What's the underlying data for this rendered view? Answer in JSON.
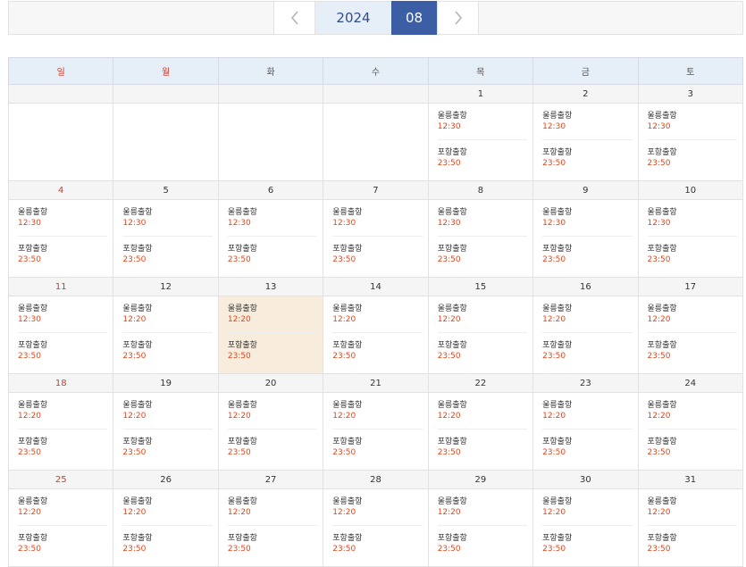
{
  "nav": {
    "year": "2024",
    "month": "08"
  },
  "weekdays": [
    "일",
    "월",
    "화",
    "수",
    "목",
    "금",
    "토"
  ],
  "weeks": [
    {
      "dates": [
        "",
        "",
        "",
        "",
        "1",
        "2",
        "3"
      ],
      "events": [
        [],
        [],
        [],
        [],
        [
          {
            "name": "울릉출항",
            "time": "12:30"
          },
          {
            "name": "포항출항",
            "time": "23:50"
          }
        ],
        [
          {
            "name": "울릉출항",
            "time": "12:30"
          },
          {
            "name": "포항출항",
            "time": "23:50"
          }
        ],
        [
          {
            "name": "울릉출항",
            "time": "12:30"
          },
          {
            "name": "포항출항",
            "time": "23:50"
          }
        ]
      ]
    },
    {
      "dates": [
        "4",
        "5",
        "6",
        "7",
        "8",
        "9",
        "10"
      ],
      "events": [
        [
          {
            "name": "울릉출항",
            "time": "12:30"
          },
          {
            "name": "포항출항",
            "time": "23:50"
          }
        ],
        [
          {
            "name": "울릉출항",
            "time": "12:30"
          },
          {
            "name": "포항출항",
            "time": "23:50"
          }
        ],
        [
          {
            "name": "울릉출항",
            "time": "12:30"
          },
          {
            "name": "포항출항",
            "time": "23:50"
          }
        ],
        [
          {
            "name": "울릉출항",
            "time": "12:30"
          },
          {
            "name": "포항출항",
            "time": "23:50"
          }
        ],
        [
          {
            "name": "울릉출항",
            "time": "12:30"
          },
          {
            "name": "포항출항",
            "time": "23:50"
          }
        ],
        [
          {
            "name": "울릉출항",
            "time": "12:30"
          },
          {
            "name": "포항출항",
            "time": "23:50"
          }
        ],
        [
          {
            "name": "울릉출항",
            "time": "12:30"
          },
          {
            "name": "포항출항",
            "time": "23:50"
          }
        ]
      ]
    },
    {
      "dates": [
        "11",
        "12",
        "13",
        "14",
        "15",
        "16",
        "17"
      ],
      "events": [
        [
          {
            "name": "울릉출항",
            "time": "12:30"
          },
          {
            "name": "포항출항",
            "time": "23:50"
          }
        ],
        [
          {
            "name": "울릉출항",
            "time": "12:20"
          },
          {
            "name": "포항출항",
            "time": "23:50"
          }
        ],
        [
          {
            "name": "울릉출항",
            "time": "12:20"
          },
          {
            "name": "포항출항",
            "time": "23:50"
          }
        ],
        [
          {
            "name": "울릉출항",
            "time": "12:20"
          },
          {
            "name": "포항출항",
            "time": "23:50"
          }
        ],
        [
          {
            "name": "울릉출항",
            "time": "12:20"
          },
          {
            "name": "포항출항",
            "time": "23:50"
          }
        ],
        [
          {
            "name": "울릉출항",
            "time": "12:20"
          },
          {
            "name": "포항출항",
            "time": "23:50"
          }
        ],
        [
          {
            "name": "울릉출항",
            "time": "12:20"
          },
          {
            "name": "포항출항",
            "time": "23:50"
          }
        ]
      ]
    },
    {
      "dates": [
        "18",
        "19",
        "20",
        "21",
        "22",
        "23",
        "24"
      ],
      "events": [
        [
          {
            "name": "울릉출항",
            "time": "12:20"
          },
          {
            "name": "포항출항",
            "time": "23:50"
          }
        ],
        [
          {
            "name": "울릉출항",
            "time": "12:20"
          },
          {
            "name": "포항출항",
            "time": "23:50"
          }
        ],
        [
          {
            "name": "울릉출항",
            "time": "12:20"
          },
          {
            "name": "포항출항",
            "time": "23:50"
          }
        ],
        [
          {
            "name": "울릉출항",
            "time": "12:20"
          },
          {
            "name": "포항출항",
            "time": "23:50"
          }
        ],
        [
          {
            "name": "울릉출항",
            "time": "12:20"
          },
          {
            "name": "포항출항",
            "time": "23:50"
          }
        ],
        [
          {
            "name": "울릉출항",
            "time": "12:20"
          },
          {
            "name": "포항출항",
            "time": "23:50"
          }
        ],
        [
          {
            "name": "울릉출항",
            "time": "12:20"
          },
          {
            "name": "포항출항",
            "time": "23:50"
          }
        ]
      ]
    },
    {
      "dates": [
        "25",
        "26",
        "27",
        "28",
        "29",
        "30",
        "31"
      ],
      "events": [
        [
          {
            "name": "울릉출항",
            "time": "12:20"
          },
          {
            "name": "포항출항",
            "time": "23:50"
          }
        ],
        [
          {
            "name": "울릉출항",
            "time": "12:20"
          },
          {
            "name": "포항출항",
            "time": "23:50"
          }
        ],
        [
          {
            "name": "울릉출항",
            "time": "12:20"
          },
          {
            "name": "포항출항",
            "time": "23:50"
          }
        ],
        [
          {
            "name": "울릉출항",
            "time": "12:20"
          },
          {
            "name": "포항출항",
            "time": "23:50"
          }
        ],
        [
          {
            "name": "울릉출항",
            "time": "12:20"
          },
          {
            "name": "포항출항",
            "time": "23:50"
          }
        ],
        [
          {
            "name": "울릉출항",
            "time": "12:20"
          },
          {
            "name": "포항출항",
            "time": "23:50"
          }
        ],
        [
          {
            "name": "울릉출항",
            "time": "12:20"
          },
          {
            "name": "포항출항",
            "time": "23:50"
          }
        ]
      ]
    }
  ],
  "highlight": {
    "date": "13"
  },
  "colors": {
    "accent": "#3b5ea5",
    "holiday": "#d23b2b",
    "time": "#e0461c",
    "today_bg": "#f8ecdc"
  }
}
